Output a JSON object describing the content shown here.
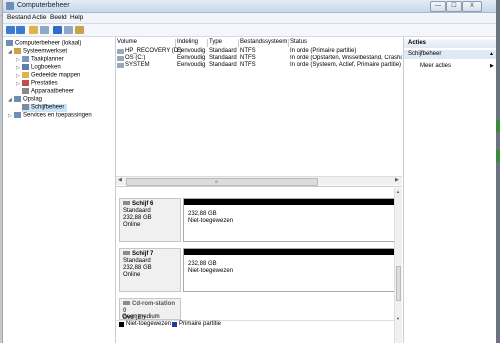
{
  "window": {
    "title": "Computerbeheer"
  },
  "window_buttons": {
    "minimize": "—",
    "maximize": "☐",
    "close": "X"
  },
  "menu": [
    "Bestand",
    "Actie",
    "Beeld",
    "Help"
  ],
  "tree": [
    {
      "label": "Computerbeheer (lokaal)",
      "icon": "computer-icon"
    },
    {
      "label": "Systeemwerkset",
      "icon": "tools-icon"
    },
    {
      "label": "Taakplanner",
      "icon": "clock-icon"
    },
    {
      "label": "Logboeken",
      "icon": "log-icon"
    },
    {
      "label": "Gedeelde mappen",
      "icon": "folder-icon"
    },
    {
      "label": "Prestaties",
      "icon": "chart-icon"
    },
    {
      "label": "Apparaatbeheer",
      "icon": "device-icon"
    },
    {
      "label": "Opslag",
      "icon": "storage-icon"
    },
    {
      "label": "Schijfbeheer",
      "icon": "disk-icon"
    },
    {
      "label": "Services en toepassingen",
      "icon": "services-icon"
    }
  ],
  "volume_list": {
    "columns": [
      "Volume",
      "Indeling",
      "Type",
      "Bestandssysteem",
      "Status"
    ],
    "rows": [
      [
        "HP_RECOVERY (D:)",
        "Eenvoudig",
        "Standaard",
        "NTFS",
        "In orde (Primaire partitie)"
      ],
      [
        "OS (C:)",
        "Eenvoudig",
        "Standaard",
        "NTFS",
        "In orde (Opstarten, Wisselbestand, Crashdu"
      ],
      [
        "SYSTEM",
        "Eenvoudig",
        "Standaard",
        "NTFS",
        "In orde (Systeem, Actief, Primaire partitie)"
      ]
    ],
    "scroll_mid": "III"
  },
  "disks": [
    {
      "name": "Schijf 6",
      "type": "Standaard",
      "size": "232,88 GB",
      "state": "Online",
      "part_size": "232,88 GB",
      "part_state": "Niet-toegewezen"
    },
    {
      "name": "Schijf 7",
      "type": "Standaard",
      "size": "232,88 GB",
      "state": "Online",
      "part_size": "232,88 GB",
      "part_state": "Niet-toegewezen"
    }
  ],
  "cdrom": {
    "name": "Cd-rom-station 0",
    "drive": "Dvd (E:)",
    "media": "Geen medium"
  },
  "legend": [
    {
      "label": "Niet-toegewezen",
      "color": "#000000"
    },
    {
      "label": "Primaire partitie",
      "color": "#1f3b9b"
    }
  ],
  "actions": {
    "header": "Acties",
    "section": "Schijfbeheer",
    "more": "Meer acties"
  },
  "colors": {
    "selection": "#cce4f7",
    "unallocated": "#000000",
    "primary": "#1f3b9b"
  }
}
